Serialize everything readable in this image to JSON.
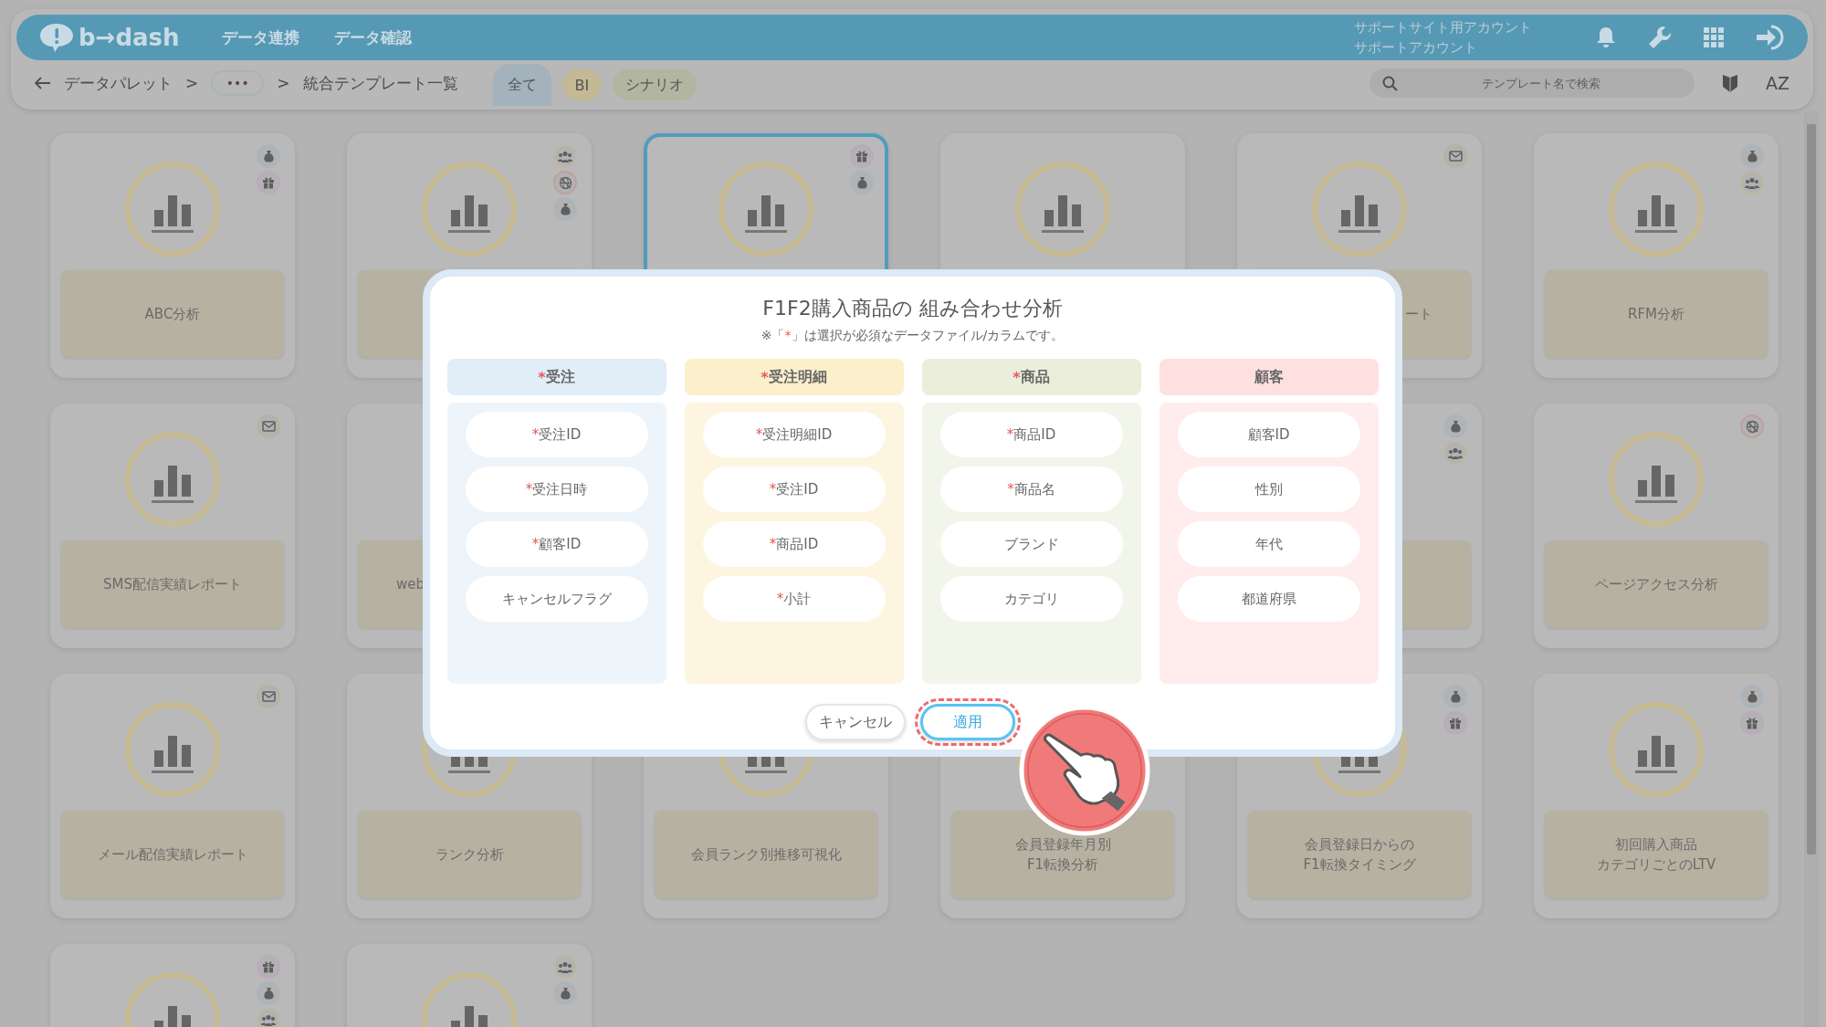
{
  "header": {
    "logo": "b→dash",
    "nav": [
      {
        "label": "データ連携"
      },
      {
        "label": "データ確認"
      }
    ],
    "account": [
      "サポートサイト用アカウント",
      "サポートアカウント"
    ]
  },
  "toolbar": {
    "breadcrumb": [
      {
        "kind": "link",
        "text": "データパレット"
      },
      {
        "kind": "sep",
        "text": ">"
      },
      {
        "kind": "more",
        "text": "•••"
      },
      {
        "kind": "sep",
        "text": ">"
      },
      {
        "kind": "text",
        "text": "統合テンプレート一覧"
      }
    ],
    "filters": [
      {
        "label": "全て",
        "selected": true,
        "color": "#a3b2bd"
      },
      {
        "label": "BI",
        "selected": false,
        "color": "#c3b995"
      },
      {
        "label": "シナリオ",
        "selected": false,
        "color": "#b2b5a0"
      }
    ],
    "search": {
      "placeholder": "テンプレート名で検索"
    },
    "sort": "AZ"
  },
  "cards": [
    {
      "lines": [
        "ABC分析"
      ],
      "chart": true,
      "icons": [
        {
          "kind": "money"
        },
        {
          "kind": "gift"
        }
      ],
      "selected": false
    },
    {
      "plate": true,
      "chart": true,
      "icons": [
        {
          "kind": "people"
        },
        {
          "kind": "globe"
        },
        {
          "kind": "money"
        }
      ],
      "selected": false
    },
    {
      "chart": true,
      "icons": [
        {
          "kind": "gift"
        },
        {
          "kind": "money"
        }
      ],
      "selected": true
    },
    {
      "chart": true,
      "selected": false
    },
    {
      "lines": [
        "ート"
      ],
      "clipped_start": true,
      "chart": true,
      "icons": [
        {
          "kind": "mail"
        }
      ],
      "selected": false
    },
    {
      "lines": [
        "RFM分析"
      ],
      "chart": true,
      "icons": [
        {
          "kind": "money"
        },
        {
          "kind": "people"
        }
      ],
      "selected": false
    },
    {
      "lines": [
        "SMS配信実績レポート"
      ],
      "chart": true,
      "icons": [
        {
          "kind": "mail"
        }
      ],
      "selected": false
    },
    {
      "lines": [
        "web"
      ],
      "clipped_end": true,
      "chart": false,
      "selected": false
    },
    {
      "covered_before": true,
      "plate": true,
      "chart": false,
      "icons": [
        {
          "kind": "money"
        },
        {
          "kind": "people"
        }
      ],
      "selected": false
    },
    {
      "lines": [
        "ページアクセス分析"
      ],
      "chart": true,
      "icons": [
        {
          "kind": "globe"
        }
      ],
      "selected": false
    },
    {
      "lines": [
        "メール配信実績レポート"
      ],
      "chart": true,
      "icons": [
        {
          "kind": "mail"
        }
      ],
      "selected": false
    },
    {
      "lines": [
        "ランク分析"
      ],
      "chart": true,
      "selected": false
    },
    {
      "lines": [
        "会員ランク別推移可視化"
      ],
      "chart": true,
      "selected": false
    },
    {
      "lines": [
        "会員登録年月別",
        "F1転換分析"
      ],
      "chart": true,
      "selected": false
    },
    {
      "lines": [
        "会員登録日からの",
        "F1転換タイミング"
      ],
      "chart": true,
      "icons": [
        {
          "kind": "money"
        },
        {
          "kind": "gift"
        }
      ],
      "selected": false
    },
    {
      "lines": [
        "初回購入商品",
        "カテゴリごとのLTV"
      ],
      "chart": true,
      "icons": [
        {
          "kind": "money"
        },
        {
          "kind": "gift"
        }
      ],
      "selected": false
    },
    {
      "chart": true,
      "icons": [
        {
          "kind": "gift"
        },
        {
          "kind": "money"
        },
        {
          "kind": "people"
        }
      ],
      "selected": false
    },
    {
      "chart": true,
      "icons": [
        {
          "kind": "people"
        },
        {
          "kind": "money"
        }
      ],
      "selected": false
    }
  ],
  "modal": {
    "title": "F1F2購入商品の 組み合わせ分析",
    "note": {
      "before": "※「",
      "mark": "*",
      "after": "」は選択が必須なデータファイル/カラムです。"
    },
    "columns": [
      {
        "name": "受注",
        "required": true,
        "color": "#e1edf7",
        "fields": [
          {
            "label": "受注ID",
            "required": true
          },
          {
            "label": "受注日時",
            "required": true
          },
          {
            "label": "顧客ID",
            "required": true
          },
          {
            "label": "キャンセルフラグ",
            "required": false
          }
        ]
      },
      {
        "name": "受注明細",
        "required": true,
        "color": "#fcefcc",
        "fields": [
          {
            "label": "受注明細ID",
            "required": true
          },
          {
            "label": "受注ID",
            "required": true
          },
          {
            "label": "商品ID",
            "required": true
          },
          {
            "label": "小計",
            "required": true
          }
        ]
      },
      {
        "name": "商品",
        "required": true,
        "color": "#eaeedb",
        "fields": [
          {
            "label": "商品ID",
            "required": true
          },
          {
            "label": "商品名",
            "required": true
          },
          {
            "label": "ブランド",
            "required": false
          },
          {
            "label": "カテゴリ",
            "required": false
          }
        ]
      },
      {
        "name": "顧客",
        "required": false,
        "color": "#ffe0e0",
        "fields": [
          {
            "label": "顧客ID",
            "required": false
          },
          {
            "label": "性別",
            "required": false
          },
          {
            "label": "年代",
            "required": false
          },
          {
            "label": "都道府県",
            "required": false
          }
        ]
      }
    ],
    "buttons": [
      {
        "label": "キャンセル",
        "kind": "secondary",
        "highlighted": false
      },
      {
        "label": "適用",
        "kind": "primary",
        "highlighted": true
      }
    ]
  }
}
